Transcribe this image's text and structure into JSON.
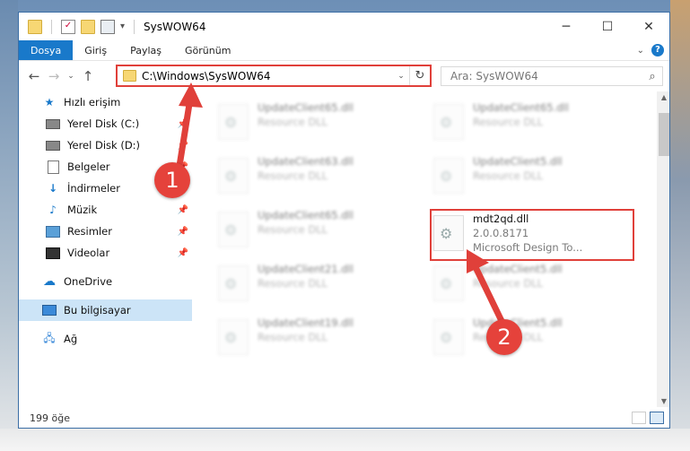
{
  "window": {
    "title": "SysWOW64"
  },
  "ribbon": {
    "tabs": [
      "Dosya",
      "Giriş",
      "Paylaş",
      "Görünüm"
    ],
    "active": "Dosya"
  },
  "address": {
    "path": "C:\\Windows\\SysWOW64"
  },
  "search": {
    "placeholder": "Ara: SysWOW64"
  },
  "sidebar": {
    "items": [
      {
        "label": "Hızlı erişim",
        "icon": "star-icon"
      },
      {
        "label": "Yerel Disk (C:)",
        "icon": "drive-icon",
        "pinned": true
      },
      {
        "label": "Yerel Disk (D:)",
        "icon": "drive-icon",
        "pinned": true
      },
      {
        "label": "Belgeler",
        "icon": "documents-icon",
        "pinned": true
      },
      {
        "label": "İndirmeler",
        "icon": "downloads-icon",
        "pinned": true
      },
      {
        "label": "Müzik",
        "icon": "music-icon",
        "pinned": true
      },
      {
        "label": "Resimler",
        "icon": "pictures-icon",
        "pinned": true
      },
      {
        "label": "Videolar",
        "icon": "videos-icon",
        "pinned": true
      },
      {
        "label": "OneDrive",
        "icon": "onedrive-icon"
      },
      {
        "label": "Bu bilgisayar",
        "icon": "computer-icon",
        "selected": true
      },
      {
        "label": "Ağ",
        "icon": "network-icon"
      }
    ]
  },
  "files": [
    {
      "name": "UpdateClient65.dll",
      "sub": "Resource DLL"
    },
    {
      "name": "UpdateClient65.dll",
      "sub": "Resource DLL"
    },
    {
      "name": "UpdateClient63.dll",
      "sub": "Resource DLL"
    },
    {
      "name": "UpdateClient5.dll",
      "sub": "Resource DLL"
    },
    {
      "name": "UpdateClient65.dll",
      "sub": "Resource DLL"
    },
    {
      "name": "mdt2qd.dll",
      "sub": "2.0.0.8171",
      "sub2": "Microsoft Design To..."
    },
    {
      "name": "UpdateClient21.dll",
      "sub": "Resource DLL"
    },
    {
      "name": "UpdateClient5.dll",
      "sub": "Resource DLL"
    },
    {
      "name": "UpdateClient19.dll",
      "sub": "Resource DLL"
    },
    {
      "name": "UpdateClient5.dll",
      "sub": "Resource DLL"
    }
  ],
  "status": {
    "count": "199 öğe"
  },
  "annotations": {
    "badge1": "1",
    "badge2": "2"
  },
  "colors": {
    "accent": "#1979ca",
    "annotation": "#e0403a"
  }
}
